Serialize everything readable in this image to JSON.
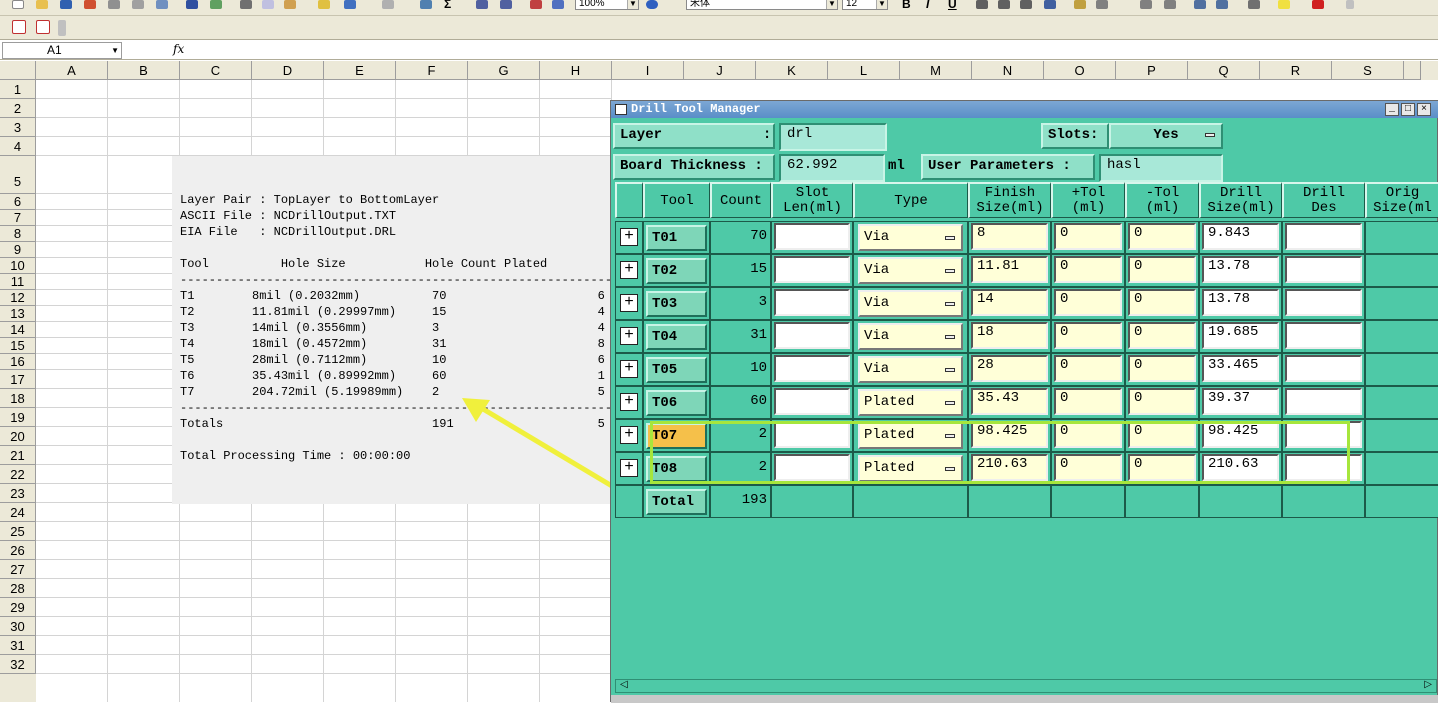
{
  "excel": {
    "zoom": "100%",
    "font_name": "宋体",
    "font_size": "12",
    "format_buttons": [
      "B",
      "I",
      "U"
    ],
    "name_box": "A1",
    "fx_label": "fx",
    "columns": [
      "A",
      "B",
      "C",
      "D",
      "E",
      "F",
      "G",
      "H",
      "I",
      "J",
      "K",
      "L",
      "M",
      "N",
      "O",
      "P",
      "Q",
      "R",
      "S"
    ],
    "rows": [
      "1",
      "2",
      "3",
      "4",
      "5",
      "6",
      "7",
      "8",
      "9",
      "10",
      "11",
      "12",
      "13",
      "14",
      "15",
      "16",
      "17",
      "18",
      "19",
      "20",
      "21",
      "22",
      "23",
      "24",
      "25",
      "26",
      "27",
      "28",
      "29",
      "30",
      "31",
      "32"
    ]
  },
  "report": {
    "lines": [
      "Layer Pair : TopLayer to BottomLayer",
      "ASCII File : NCDrillOutput.TXT",
      "EIA File   : NCDrillOutput.DRL",
      "",
      "Tool          Hole Size           Hole Count Plated",
      "------------------------------------------------------------",
      "T1        8mil (0.2032mm)          70                     6",
      "T2        11.81mil (0.29997mm)     15                     4",
      "T3        14mil (0.3556mm)         3                      4",
      "T4        18mil (0.4572mm)         31                     8",
      "T5        28mil (0.7112mm)         10                     6",
      "T6        35.43mil (0.89992mm)     60                     1",
      "T7        204.72mil (5.19989mm)    2                      5",
      "------------------------------------------------------------",
      "Totals                             191                    5",
      "",
      "Total Processing Time : 00:00:00"
    ]
  },
  "dtm": {
    "title": "Drill Tool Manager",
    "layer_label": "Layer            :",
    "layer_value": "drl",
    "slots_label": "Slots:",
    "slots_value": "Yes",
    "thickness_label": "Board Thickness :",
    "thickness_value": "62.992",
    "thickness_unit": "ml",
    "user_params_label": "User Parameters :",
    "user_params_value": "hasl",
    "headers": [
      "Tool",
      "Count",
      "Slot\nLen(ml)",
      "Type",
      "Finish\nSize(ml)",
      "+Tol\n(ml)",
      "-Tol\n(ml)",
      "Drill\nSize(ml)",
      "Drill\nDes",
      "Orig\nSize(ml"
    ],
    "rows": [
      {
        "tool": "T01",
        "count": "70",
        "slot": "",
        "type": "Via",
        "finish": "8",
        "ptol": "0",
        "ntol": "0",
        "drill": "9.843",
        "des": ""
      },
      {
        "tool": "T02",
        "count": "15",
        "slot": "",
        "type": "Via",
        "finish": "11.81",
        "ptol": "0",
        "ntol": "0",
        "drill": "13.78",
        "des": ""
      },
      {
        "tool": "T03",
        "count": "3",
        "slot": "",
        "type": "Via",
        "finish": "14",
        "ptol": "0",
        "ntol": "0",
        "drill": "13.78",
        "des": ""
      },
      {
        "tool": "T04",
        "count": "31",
        "slot": "",
        "type": "Via",
        "finish": "18",
        "ptol": "0",
        "ntol": "0",
        "drill": "19.685",
        "des": ""
      },
      {
        "tool": "T05",
        "count": "10",
        "slot": "",
        "type": "Via",
        "finish": "28",
        "ptol": "0",
        "ntol": "0",
        "drill": "33.465",
        "des": ""
      },
      {
        "tool": "T06",
        "count": "60",
        "slot": "",
        "type": "Plated",
        "finish": "35.43",
        "ptol": "0",
        "ntol": "0",
        "drill": "39.37",
        "des": ""
      },
      {
        "tool": "T07",
        "count": "2",
        "slot": "",
        "type": "Plated",
        "finish": "98.425",
        "ptol": "0",
        "ntol": "0",
        "drill": "98.425",
        "des": ""
      },
      {
        "tool": "T08",
        "count": "2",
        "slot": "",
        "type": "Plated",
        "finish": "210.63",
        "ptol": "0",
        "ntol": "0",
        "drill": "210.63",
        "des": ""
      }
    ],
    "total_label": "Total",
    "total_count": "193",
    "selected_tool": "T07",
    "highlight_color": "#a6e63c",
    "arrow_color": "#f0f03c"
  }
}
